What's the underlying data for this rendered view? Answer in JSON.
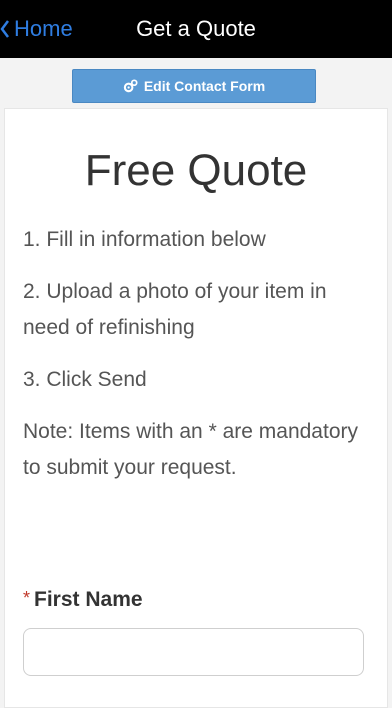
{
  "navbar": {
    "back_label": "Home",
    "title": "Get a Quote"
  },
  "toolbar": {
    "edit_label": "Edit Contact Form",
    "edit_icon": "gears-icon"
  },
  "content": {
    "heading": "Free Quote",
    "step1": "1. Fill in information below",
    "step2": "2. Upload a photo of your item in need of refinishing",
    "step3": "3. Click Send",
    "note": "Note: Items with an * are mandatory to submit your request."
  },
  "form": {
    "first_name": {
      "required_marker": "*",
      "label": "First Name",
      "value": "",
      "placeholder": ""
    }
  },
  "colors": {
    "accent": "#2f7de1",
    "button": "#5b9bd5",
    "navbar": "#000000",
    "required": "#c0392b"
  }
}
